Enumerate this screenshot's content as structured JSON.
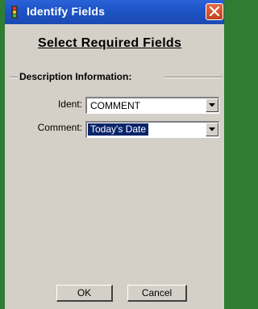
{
  "window": {
    "title": "Identify Fields",
    "title_bar_color": "#1f55c8",
    "close_button_color": "#d0532b"
  },
  "heading": "Select Required Fields",
  "group": {
    "label": "Description Information:"
  },
  "fields": {
    "ident": {
      "label": "Ident:",
      "value": "COMMENT"
    },
    "comment": {
      "label": "Comment:",
      "value": "Today's Date"
    }
  },
  "buttons": {
    "ok": "OK",
    "cancel": "Cancel"
  },
  "icons": {
    "app": "traffic-light-icon",
    "close": "close-icon",
    "dropdown": "chevron-down-icon"
  }
}
